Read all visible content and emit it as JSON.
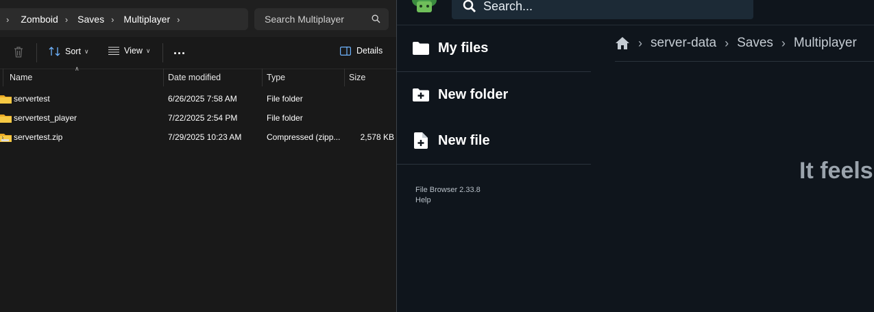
{
  "explorer": {
    "breadcrumb": [
      "Zomboid",
      "Saves",
      "Multiplayer"
    ],
    "search_placeholder": "Search Multiplayer",
    "toolbar": {
      "sort_label": "Sort",
      "view_label": "View",
      "more_label": "...",
      "details_label": "Details"
    },
    "columns": {
      "name": "Name",
      "date": "Date modified",
      "type": "Type",
      "size": "Size"
    },
    "rows": [
      {
        "name": "servertest",
        "date": "6/26/2025 7:58 AM",
        "type": "File folder",
        "size": "",
        "icon": "folder-icon"
      },
      {
        "name": "servertest_player",
        "date": "7/22/2025 2:54 PM",
        "type": "File folder",
        "size": "",
        "icon": "folder-icon"
      },
      {
        "name": "servertest.zip",
        "date": "7/29/2025 10:23 AM",
        "type": "Compressed (zipp...",
        "size": "2,578 KB",
        "icon": "zip-folder-icon"
      }
    ]
  },
  "filebrowser": {
    "search_placeholder": "Search...",
    "sidebar": [
      {
        "label": "My files",
        "icon": "folder-icon"
      },
      {
        "label": "New folder",
        "icon": "new-folder-icon"
      },
      {
        "label": "New file",
        "icon": "new-file-icon"
      }
    ],
    "version": "File Browser 2.33.8",
    "help": "Help",
    "breadcrumb": [
      "server-data",
      "Saves",
      "Multiplayer"
    ],
    "empty_message": "It feels lonely here..."
  },
  "colors": {
    "explorer_bg": "#191919",
    "folder_yellow": "#f3c13a",
    "filebrowser_bg": "#0f151c",
    "filebrowser_search": "#1c2a36"
  }
}
